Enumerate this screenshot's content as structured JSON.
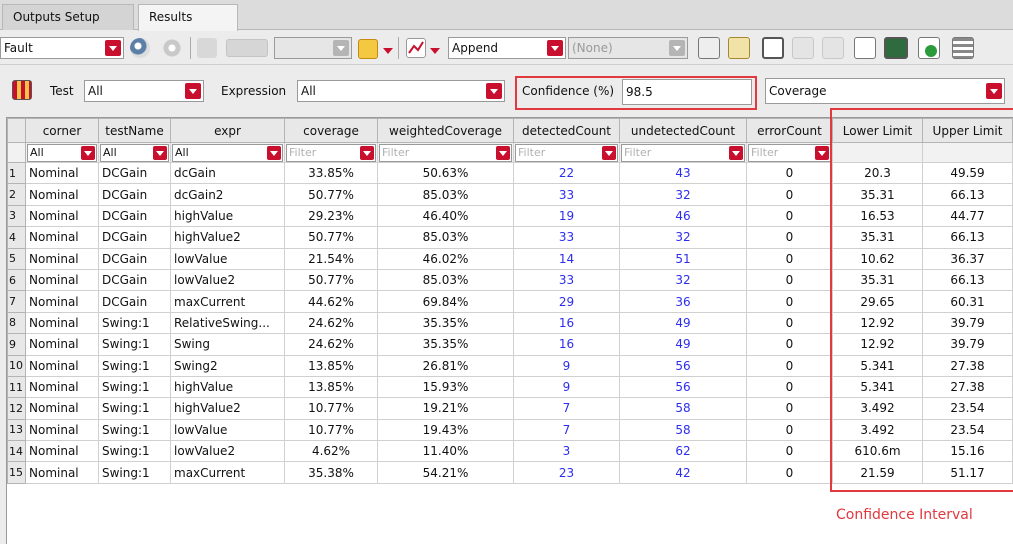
{
  "tabs": [
    {
      "label": "Outputs Setup"
    },
    {
      "label": "Results"
    }
  ],
  "toolbar": {
    "mode_value": "Fault",
    "append_value": "Append",
    "none_value": "(None)"
  },
  "filters": {
    "test_label": "Test",
    "test_value": "All",
    "expression_label": "Expression",
    "expression_value": "All",
    "confidence_label": "Confidence (%)",
    "confidence_value": "98.5",
    "metric_value": "Coverage"
  },
  "table": {
    "columns": [
      "corner",
      "testName",
      "expr",
      "coverage",
      "weightedCoverage",
      "detectedCount",
      "undetectedCount",
      "errorCount",
      "Lower Limit",
      "Upper Limit"
    ],
    "filter_row": {
      "all": "All",
      "placeholder": "Filter"
    },
    "rows": [
      {
        "n": "1",
        "corner": "Nominal",
        "test": "DCGain",
        "expr": "dcGain",
        "coverage": "33.85%",
        "weighted": "50.63%",
        "detected": "22",
        "undetected": "43",
        "error": "0",
        "lower": "20.3",
        "upper": "49.59"
      },
      {
        "n": "2",
        "corner": "Nominal",
        "test": "DCGain",
        "expr": "dcGain2",
        "coverage": "50.77%",
        "weighted": "85.03%",
        "detected": "33",
        "undetected": "32",
        "error": "0",
        "lower": "35.31",
        "upper": "66.13"
      },
      {
        "n": "3",
        "corner": "Nominal",
        "test": "DCGain",
        "expr": "highValue",
        "coverage": "29.23%",
        "weighted": "46.40%",
        "detected": "19",
        "undetected": "46",
        "error": "0",
        "lower": "16.53",
        "upper": "44.77"
      },
      {
        "n": "4",
        "corner": "Nominal",
        "test": "DCGain",
        "expr": "highValue2",
        "coverage": "50.77%",
        "weighted": "85.03%",
        "detected": "33",
        "undetected": "32",
        "error": "0",
        "lower": "35.31",
        "upper": "66.13"
      },
      {
        "n": "5",
        "corner": "Nominal",
        "test": "DCGain",
        "expr": "lowValue",
        "coverage": "21.54%",
        "weighted": "46.02%",
        "detected": "14",
        "undetected": "51",
        "error": "0",
        "lower": "10.62",
        "upper": "36.37"
      },
      {
        "n": "6",
        "corner": "Nominal",
        "test": "DCGain",
        "expr": "lowValue2",
        "coverage": "50.77%",
        "weighted": "85.03%",
        "detected": "33",
        "undetected": "32",
        "error": "0",
        "lower": "35.31",
        "upper": "66.13"
      },
      {
        "n": "7",
        "corner": "Nominal",
        "test": "DCGain",
        "expr": "maxCurrent",
        "coverage": "44.62%",
        "weighted": "69.84%",
        "detected": "29",
        "undetected": "36",
        "error": "0",
        "lower": "29.65",
        "upper": "60.31"
      },
      {
        "n": "8",
        "corner": "Nominal",
        "test": "Swing:1",
        "expr": "RelativeSwing...",
        "coverage": "24.62%",
        "weighted": "35.35%",
        "detected": "16",
        "undetected": "49",
        "error": "0",
        "lower": "12.92",
        "upper": "39.79"
      },
      {
        "n": "9",
        "corner": "Nominal",
        "test": "Swing:1",
        "expr": "Swing",
        "coverage": "24.62%",
        "weighted": "35.35%",
        "detected": "16",
        "undetected": "49",
        "error": "0",
        "lower": "12.92",
        "upper": "39.79"
      },
      {
        "n": "10",
        "corner": "Nominal",
        "test": "Swing:1",
        "expr": "Swing2",
        "coverage": "13.85%",
        "weighted": "26.81%",
        "detected": "9",
        "undetected": "56",
        "error": "0",
        "lower": "5.341",
        "upper": "27.38"
      },
      {
        "n": "11",
        "corner": "Nominal",
        "test": "Swing:1",
        "expr": "highValue",
        "coverage": "13.85%",
        "weighted": "15.93%",
        "detected": "9",
        "undetected": "56",
        "error": "0",
        "lower": "5.341",
        "upper": "27.38"
      },
      {
        "n": "12",
        "corner": "Nominal",
        "test": "Swing:1",
        "expr": "highValue2",
        "coverage": "10.77%",
        "weighted": "19.21%",
        "detected": "7",
        "undetected": "58",
        "error": "0",
        "lower": "3.492",
        "upper": "23.54"
      },
      {
        "n": "13",
        "corner": "Nominal",
        "test": "Swing:1",
        "expr": "lowValue",
        "coverage": "10.77%",
        "weighted": "19.43%",
        "detected": "7",
        "undetected": "58",
        "error": "0",
        "lower": "3.492",
        "upper": "23.54"
      },
      {
        "n": "14",
        "corner": "Nominal",
        "test": "Swing:1",
        "expr": "lowValue2",
        "coverage": "4.62%",
        "weighted": "11.40%",
        "detected": "3",
        "undetected": "62",
        "error": "0",
        "lower": "610.6m",
        "upper": "15.16"
      },
      {
        "n": "15",
        "corner": "Nominal",
        "test": "Swing:1",
        "expr": "maxCurrent",
        "coverage": "35.38%",
        "weighted": "54.21%",
        "detected": "23",
        "undetected": "42",
        "error": "0",
        "lower": "21.59",
        "upper": "51.17"
      }
    ]
  },
  "annotation": {
    "label": "Confidence Interval",
    "color": "#e0393e"
  },
  "colors": {
    "accent_red": "#c8102e",
    "link_blue": "#2d2df0"
  }
}
